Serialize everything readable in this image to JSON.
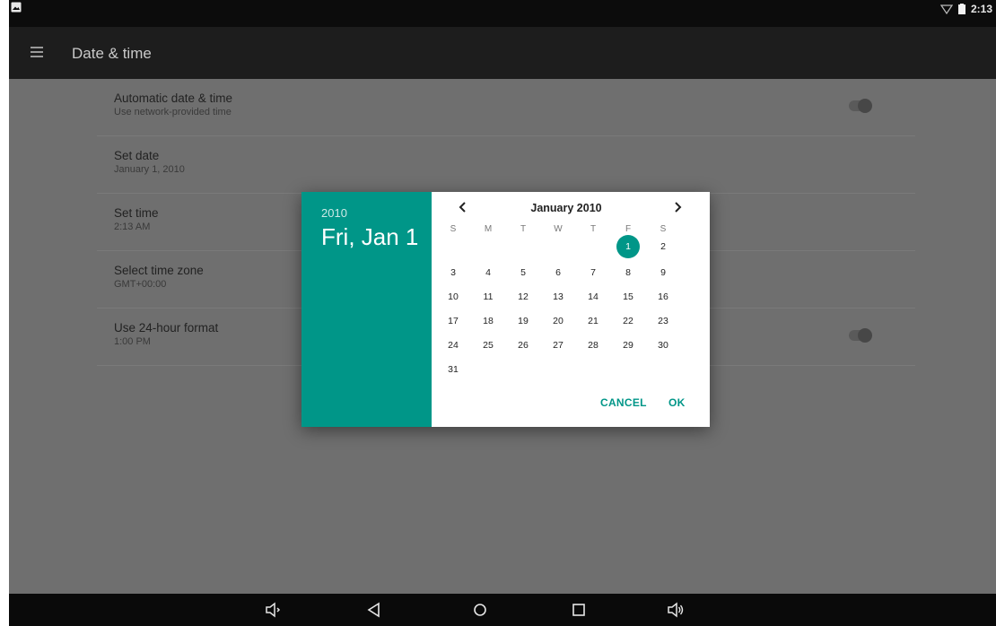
{
  "status_bar": {
    "time": "2:13"
  },
  "app_bar": {
    "title": "Date & time"
  },
  "settings": [
    {
      "title": "Automatic date & time",
      "subtitle": "Use network-provided time",
      "toggle": false
    },
    {
      "title": "Set date",
      "subtitle": "January 1, 2010"
    },
    {
      "title": "Set time",
      "subtitle": "2:13 AM"
    },
    {
      "title": "Select time zone",
      "subtitle": "GMT+00:00"
    },
    {
      "title": "Use 24-hour format",
      "subtitle": "1:00 PM",
      "toggle": false
    }
  ],
  "dialog": {
    "year": "2010",
    "date_line": "Fri, Jan 1",
    "month_label": "January 2010",
    "weekdays": [
      "S",
      "M",
      "T",
      "W",
      "T",
      "F",
      "S"
    ],
    "days": [
      "1",
      "2",
      "3",
      "4",
      "5",
      "6",
      "7",
      "8",
      "9",
      "10",
      "11",
      "12",
      "13",
      "14",
      "15",
      "16",
      "17",
      "18",
      "19",
      "20",
      "21",
      "22",
      "23",
      "24",
      "25",
      "26",
      "27",
      "28",
      "29",
      "30",
      "31"
    ],
    "first_weekday_index": 5,
    "selected_day": "1",
    "cancel_label": "CANCEL",
    "ok_label": "OK",
    "accent_color": "#009688"
  },
  "nav_bar": {
    "icons": [
      "volume-down-icon",
      "back-icon",
      "home-icon",
      "recents-icon",
      "volume-up-icon"
    ]
  }
}
